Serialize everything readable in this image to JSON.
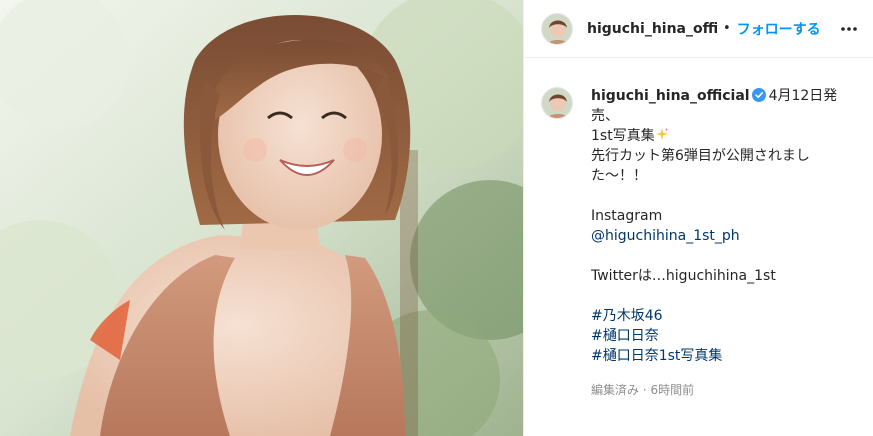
{
  "header": {
    "username": "higuchi_hina_official",
    "separator": "•",
    "follow_label": "フォローする"
  },
  "caption": {
    "username": "higuchi_hina_official",
    "line1": "4月12日発売、",
    "line2": "1st写真集",
    "line3": "先行カット第6弾目が公開されまし",
    "line4": "た～！！",
    "instagram_label": "Instagram",
    "instagram_handle": "@higuchihina_1st_ph",
    "twitter_line": "Twitterは…higuchihina_1st",
    "hashtags": [
      "#乃木坂46",
      "#樋口日奈",
      "#樋口日奈1st写真集"
    ],
    "meta": "編集済み · 6時間前"
  },
  "colors": {
    "verified": "#3897f0",
    "follow": "#0095f6",
    "link": "#00376b",
    "meta": "#8e8e8e"
  },
  "icons": {
    "more": "more-horizontal-icon",
    "verified": "verified-badge-icon",
    "sparkle": "sparkles-emoji"
  }
}
